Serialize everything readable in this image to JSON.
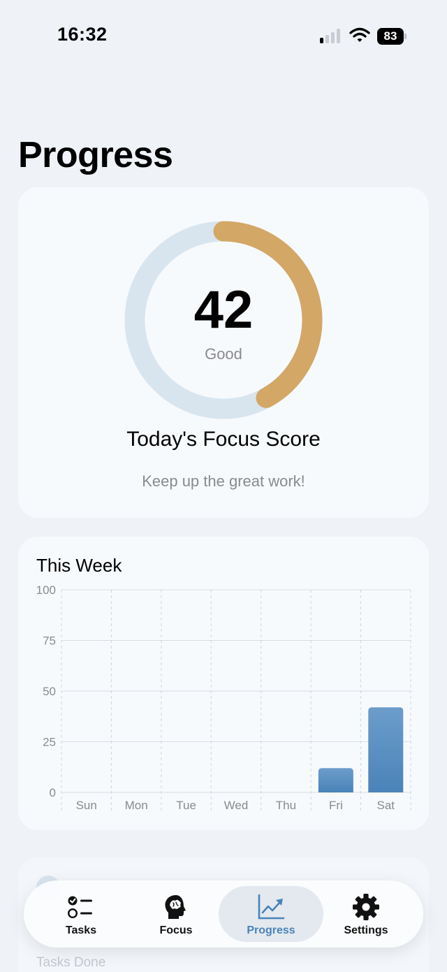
{
  "status_bar": {
    "time": "16:32",
    "battery": "83"
  },
  "page": {
    "title": "Progress"
  },
  "score_card": {
    "score": "42",
    "rating": "Good",
    "title": "Today's Focus Score",
    "subtitle": "Keep up the great work!",
    "progress_fraction": 0.42,
    "colors": {
      "progress": "#d3a766",
      "track": "#d8e5ef"
    }
  },
  "week_card": {
    "title": "This Week"
  },
  "chart_data": {
    "type": "bar",
    "title": "This Week",
    "categories": [
      "Sun",
      "Mon",
      "Tue",
      "Wed",
      "Thu",
      "Fri",
      "Sat"
    ],
    "values": [
      0,
      0,
      0,
      0,
      0,
      12,
      42
    ],
    "ylim": [
      0,
      100
    ],
    "yticks": [
      "0",
      "25",
      "50",
      "75",
      "100"
    ],
    "grid": true,
    "bar_color": "#4a83b8"
  },
  "tasks_card": {
    "label": "Tasks Done"
  },
  "tab_bar": {
    "tabs": [
      {
        "label": "Tasks",
        "icon": "checklist-icon",
        "active": false
      },
      {
        "label": "Focus",
        "icon": "brain-head-icon",
        "active": false
      },
      {
        "label": "Progress",
        "icon": "chart-trend-icon",
        "active": true
      },
      {
        "label": "Settings",
        "icon": "gear-icon",
        "active": false
      }
    ],
    "colors": {
      "active": "#4a83b8"
    }
  }
}
